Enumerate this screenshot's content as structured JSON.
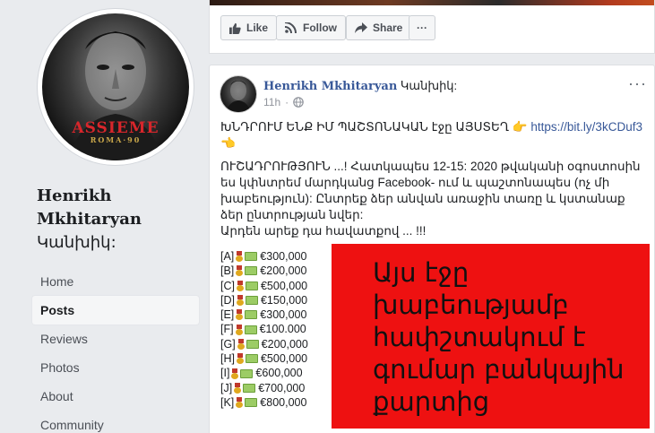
{
  "page": {
    "name_line1": "Henrikh",
    "name_line2": "Mkhitaryan",
    "name_line3": "Կանխիկ:",
    "avatar_brand": "ASSIEME",
    "avatar_brand_sub": "ROMA·90"
  },
  "nav": {
    "items": [
      {
        "label": "Home",
        "active": false
      },
      {
        "label": "Posts",
        "active": true
      },
      {
        "label": "Reviews",
        "active": false
      },
      {
        "label": "Photos",
        "active": false
      },
      {
        "label": "About",
        "active": false
      },
      {
        "label": "Community",
        "active": false
      }
    ]
  },
  "actions": {
    "like": "Like",
    "follow": "Follow",
    "share": "Share",
    "more": "···"
  },
  "post": {
    "author": "Henrikh Mkhitaryan",
    "author_suffix": "Կանխիկ:",
    "time": "11h",
    "more": "···",
    "headline": "ԽՆԴՐՈՒՄ ԵՆՔ ԻՄ ՊԱՇՏՈՆԱԿԱՆ էջը ԱՅՍՏԵՂ",
    "headline_emoji": "👉",
    "link": "https://bit.ly/3kCDuf3",
    "link_emoji": "👈",
    "paragraph": "ՈՒՇԱԴՐՈՒԹՅՈՒՆ ...! Հատկապես 12-15: 2020 թվականի օգոստոսին ես կփնտրեմ մարդկանց Facebook- ում և պաշտոնապես (ոչ մի խաբեություն): Ընտրեք ձեր անվան առաջին տառը և կստանաք ձեր ընտրության նվեր:",
    "closing": "Արդեն արեք դա հավատքով ... !!!",
    "prizes": [
      {
        "letter": "[A]",
        "amount": "€300,000"
      },
      {
        "letter": "[B]",
        "amount": "€200,000"
      },
      {
        "letter": "[C]",
        "amount": "€500,000"
      },
      {
        "letter": "[D]",
        "amount": "€150,000"
      },
      {
        "letter": "[E]",
        "amount": "€300,000"
      },
      {
        "letter": "[F]",
        "amount": "€100.000"
      },
      {
        "letter": "[G]",
        "amount": "€200,000"
      },
      {
        "letter": "[H]",
        "amount": "€500,000"
      },
      {
        "letter": "[I]",
        "amount": "€600,000"
      },
      {
        "letter": "[J]",
        "amount": "€700,000"
      },
      {
        "letter": "[K]",
        "amount": "€800,000"
      }
    ]
  },
  "overlay": {
    "lines": [
      "Այս էջը",
      "խաբեությամբ",
      "հափշտակում է",
      "գումար բանկային",
      "քարտից"
    ],
    "color": "#ee1111"
  }
}
